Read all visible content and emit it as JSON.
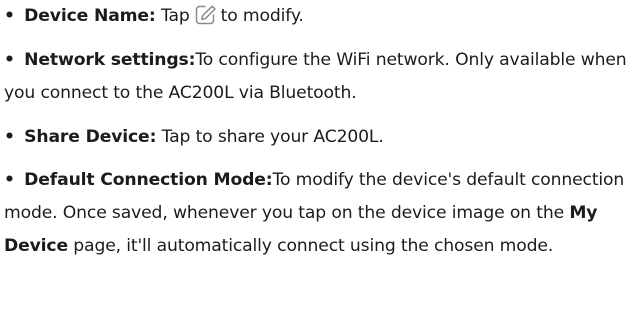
{
  "items": [
    {
      "bullet": "•",
      "label": "Device Name:",
      "text_before_icon": "Tap",
      "icon": "edit-icon",
      "text_after_icon": "to modify."
    },
    {
      "bullet": "•",
      "label": "Network settings:",
      "text": "To configure the WiFi network. Only available when you connect to the AC200L via Bluetooth."
    },
    {
      "bullet": "•",
      "label": "Share Device:",
      "text": "Tap to share your AC200L."
    },
    {
      "bullet": "•",
      "label": "Default Connection Mode:",
      "text_before_bold": "To modify the device's default connection mode. Once saved, whenever you tap on the device image on the",
      "bold_inline": "My Device",
      "text_after_bold": "page, it'll automatically connect using the chosen mode."
    }
  ]
}
